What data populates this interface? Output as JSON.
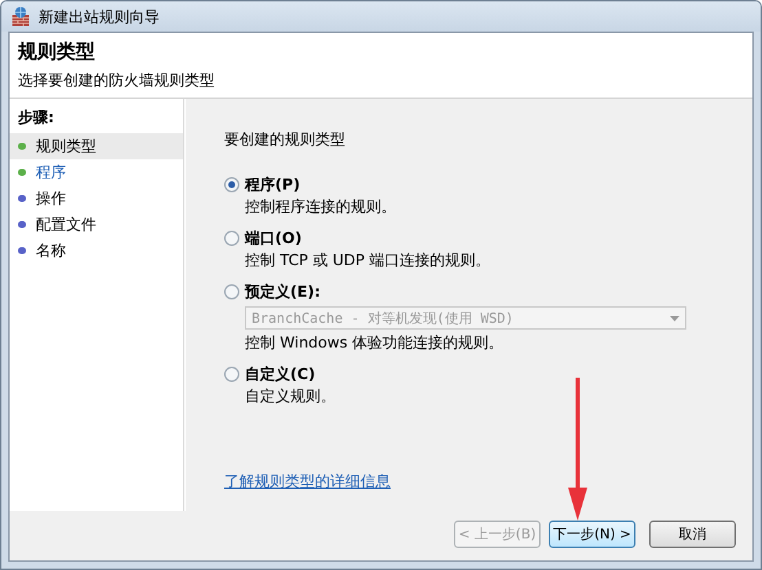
{
  "window": {
    "title": "新建出站规则向导"
  },
  "header": {
    "title": "规则类型",
    "subtitle": "选择要创建的防火墙规则类型"
  },
  "steps": {
    "heading": "步骤:",
    "items": [
      {
        "label": "规则类型",
        "selected": true,
        "link": false,
        "color": "#5cb04a"
      },
      {
        "label": "程序",
        "selected": false,
        "link": true,
        "color": "#5cb04a"
      },
      {
        "label": "操作",
        "selected": false,
        "link": false,
        "color": "#5862c8"
      },
      {
        "label": "配置文件",
        "selected": false,
        "link": false,
        "color": "#5862c8"
      },
      {
        "label": "名称",
        "selected": false,
        "link": false,
        "color": "#5862c8"
      }
    ]
  },
  "question": "要创建的规则类型",
  "options": [
    {
      "label": "程序(P)",
      "description": "控制程序连接的规则。",
      "selected": true
    },
    {
      "label": "端口(O)",
      "description": "控制 TCP 或 UDP 端口连接的规则。",
      "selected": false
    },
    {
      "label": "预定义(E):",
      "description": "控制 Windows 体验功能连接的规则。",
      "selected": false,
      "dropdown": {
        "value": "BranchCache - 对等机发现(使用 WSD)",
        "disabled": true
      }
    },
    {
      "label": "自定义(C)",
      "description": "自定义规则。",
      "selected": false
    }
  ],
  "help_link": "了解规则类型的详细信息",
  "buttons": [
    {
      "label": "< 上一步(B)",
      "disabled": true,
      "default": false
    },
    {
      "label": "下一步(N) >",
      "disabled": false,
      "default": true
    },
    {
      "label": "取消",
      "disabled": false,
      "default": false
    }
  ],
  "annotations": [
    {
      "kind": "arrow"
    }
  ]
}
